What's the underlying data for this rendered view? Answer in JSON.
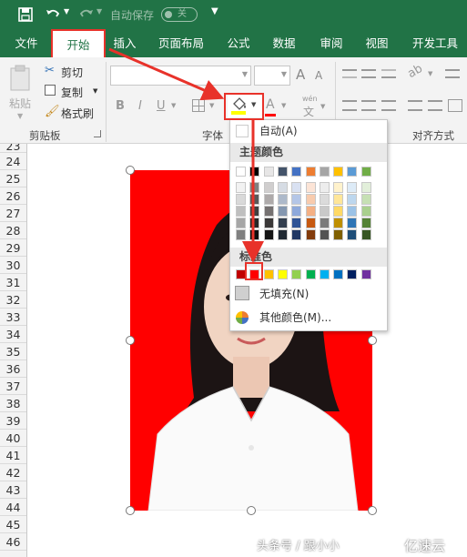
{
  "titlebar": {
    "autosave_label": "自动保存",
    "autosave_state": "关"
  },
  "tabs": [
    {
      "label": "文件"
    },
    {
      "label": "开始"
    },
    {
      "label": "插入"
    },
    {
      "label": "页面布局"
    },
    {
      "label": "公式"
    },
    {
      "label": "数据"
    },
    {
      "label": "审阅"
    },
    {
      "label": "视图"
    },
    {
      "label": "开发工具"
    }
  ],
  "clipboard": {
    "paste": "粘贴",
    "cut": "剪切",
    "copy": "复制",
    "format_painter": "格式刷",
    "group": "剪贴板"
  },
  "font": {
    "bold": "B",
    "italic": "I",
    "underline": "U",
    "grow": "A",
    "shrink": "A",
    "color_a": "A",
    "phonetic": "wén",
    "phonetic_char": "文",
    "group": "字体"
  },
  "alignment": {
    "group": "对齐方式"
  },
  "rows": [
    "23",
    "24",
    "25",
    "26",
    "27",
    "28",
    "29",
    "30",
    "31",
    "32",
    "33",
    "34",
    "35",
    "36",
    "37",
    "38",
    "39",
    "40",
    "41",
    "42",
    "43",
    "44",
    "45",
    "46"
  ],
  "fill_menu": {
    "auto": "自动(A)",
    "theme_header": "主题颜色",
    "standard_header": "标准色",
    "no_fill": "无填充(N)",
    "more_colors": "其他颜色(M)...",
    "theme_top": [
      "#ffffff",
      "#000000",
      "#e7e6e6",
      "#44546a",
      "#4472c4",
      "#ed7d31",
      "#a5a5a5",
      "#ffc000",
      "#5b9bd5",
      "#70ad47"
    ],
    "theme_shades": [
      [
        "#f2f2f2",
        "#7f7f7f",
        "#d0cece",
        "#d6dce4",
        "#d9e1f2",
        "#fce4d6",
        "#ededed",
        "#fff2cc",
        "#ddebf7",
        "#e2efda"
      ],
      [
        "#d9d9d9",
        "#595959",
        "#aeaaaa",
        "#adb9ca",
        "#b4c6e7",
        "#f8cbad",
        "#dbdbdb",
        "#ffe699",
        "#bdd7ee",
        "#c6e0b4"
      ],
      [
        "#bfbfbf",
        "#404040",
        "#757171",
        "#8497b0",
        "#8ea9db",
        "#f4b084",
        "#c9c9c9",
        "#ffd966",
        "#9bc2e6",
        "#a9d08e"
      ],
      [
        "#a6a6a6",
        "#262626",
        "#3a3838",
        "#333f4f",
        "#305496",
        "#c65911",
        "#7b7b7b",
        "#bf8f00",
        "#2f75b5",
        "#548235"
      ],
      [
        "#808080",
        "#0d0d0d",
        "#161616",
        "#222b35",
        "#203764",
        "#833c0c",
        "#525252",
        "#806000",
        "#1f4e78",
        "#375623"
      ]
    ],
    "standard": [
      "#c00000",
      "#ff0000",
      "#ffc000",
      "#ffff00",
      "#92d050",
      "#00b050",
      "#00b0f0",
      "#0070c0",
      "#002060",
      "#7030a0"
    ]
  },
  "photo": {
    "background": "#ff0000"
  },
  "watermark": {
    "left": "头条号 / 跟小小",
    "right": "亿速云"
  },
  "colors": {
    "accent": "#217346",
    "highlight": "#e8322a"
  }
}
